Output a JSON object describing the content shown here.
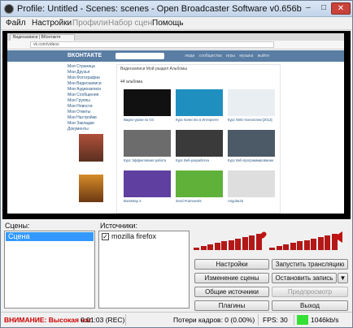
{
  "window": {
    "title": "Profile: Untitled - Scenes: scenes - Open Broadcaster Software v0.656b",
    "controls": {
      "minimize": "–",
      "maximize": "□",
      "close": "✕"
    }
  },
  "menu": {
    "items": [
      "Файл",
      "Настройки",
      "Профили",
      "Набор сцен",
      "Помощь"
    ]
  },
  "preview": {
    "browser": {
      "tab": "Видеозаписи | ВКонтакте",
      "url": "vk.com/videos"
    },
    "vk": {
      "logo": "ВКОНТАКТЕ",
      "nav": "люди сообщества игры музыка выйти",
      "sidebar": [
        "Моя Страница",
        "Мои Друзья",
        "Мои Фотографии",
        "Мои Видеозаписи",
        "Мои Аудиозаписи",
        "Мои Сообщения",
        "Мои Группы",
        "Мои Новости",
        "Мои Ответы",
        "Мои Настройки",
        "Мои Закладки",
        "Документы"
      ],
      "tabs": "Видеозаписи  Мой раздел  Альбомы",
      "count": "44 альбома",
      "videos": [
        {
          "title": "Видео-уроки по Git",
          "color": "#111111"
        },
        {
          "title": "Курс Качество в Интернете",
          "color": "#1f8fc0"
        },
        {
          "title": "Курс Web-технологии [2013]",
          "color": "#e8eef2"
        },
        {
          "title": "Курс Эффективная работа",
          "color": "#6c6c6c"
        },
        {
          "title": "Курс Веб-разработка",
          "color": "#3a3a3a"
        },
        {
          "title": "Курс Веб-программирование",
          "color": "#4c5966"
        },
        {
          "title": "Bootstrap 3",
          "color": "#5f3fa0"
        },
        {
          "title": "Zend Framework",
          "color": "#5fb13a"
        },
        {
          "title": "AngularJS",
          "color": "#dedede"
        }
      ]
    }
  },
  "scenes": {
    "label": "Сцены:",
    "items": [
      "Сцена"
    ]
  },
  "sources": {
    "label": "Источники:",
    "items": [
      {
        "name": "mozilla firefox",
        "checked": "✓"
      }
    ]
  },
  "audio": {
    "mic_icon": "microphone-icon",
    "speaker_icon": "speaker-icon",
    "mic_level": 1.0,
    "desktop_level": 1.0,
    "color": "#b41717"
  },
  "buttons": {
    "settings": "Настройки",
    "start_stream": "Запустить трансляцию",
    "scene_edit": "Изменение сцены",
    "stop_record": "Остановить запись",
    "dropdown": "▼",
    "global_sources": "Общие источники",
    "preview": "Предпросмотр",
    "plugins": "Плагины",
    "exit": "Выход"
  },
  "status": {
    "warning": "ВНИМАНИЕ: Высокая наг",
    "time": "0:01:03 (REC)",
    "dropped": "Потери кадров: 0 (0.00%)",
    "fps": "FPS: 30",
    "bitrate": "1046kb/s",
    "warning_color": "#cc0000",
    "bitrate_color": "#34e034"
  }
}
